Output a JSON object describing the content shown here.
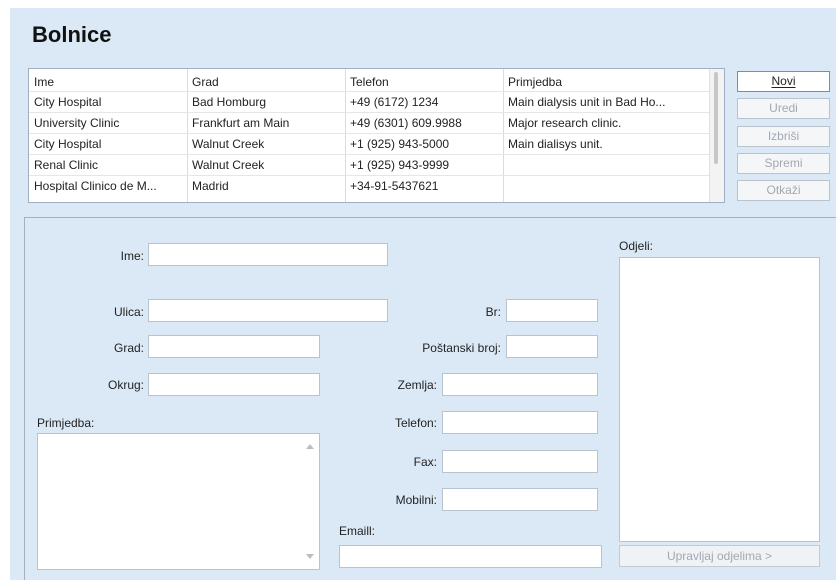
{
  "page": {
    "title": "Bolnice"
  },
  "table": {
    "columns": [
      "Ime",
      "Grad",
      "Telefon",
      "Primjedba"
    ],
    "rows": [
      [
        "City Hospital",
        "Bad Homburg",
        "+49 (6172) 1234",
        "Main dialysis unit in Bad Ho..."
      ],
      [
        "University Clinic",
        "Frankfurt am Main",
        "+49 (6301) 609.9988",
        "Major research clinic."
      ],
      [
        "City Hospital",
        "Walnut Creek",
        "+1 (925) 943-5000",
        "Main dialisys unit."
      ],
      [
        "Renal Clinic",
        "Walnut Creek",
        "+1 (925) 943-9999",
        ""
      ],
      [
        "Hospital Clinico de M...",
        "Madrid",
        "+34-91-5437621",
        ""
      ]
    ]
  },
  "buttons": [
    {
      "label": "Novi",
      "enabled": true
    },
    {
      "label": "Uredi",
      "enabled": false
    },
    {
      "label": "Izbriši",
      "enabled": false
    },
    {
      "label": "Spremi",
      "enabled": false
    },
    {
      "label": "Otkaži",
      "enabled": false
    }
  ],
  "form": {
    "ime_label": "Ime:",
    "ime_value": "",
    "ulica_label": "Ulica:",
    "ulica_value": "",
    "br_label": "Br:",
    "br_value": "",
    "grad_label": "Grad:",
    "grad_value": "",
    "postanski_label": "Poštanski broj:",
    "postanski_value": "",
    "okrug_label": "Okrug:",
    "okrug_value": "",
    "zemlja_label": "Zemlja:",
    "zemlja_value": "",
    "telefon_label": "Telefon:",
    "telefon_value": "",
    "fax_label": "Fax:",
    "fax_value": "",
    "mobilni_label": "Mobilni:",
    "mobilni_value": "",
    "email_label": "Emaill:",
    "email_value": "",
    "primjedba_label": "Primjedba:",
    "primjedba_value": "",
    "odjeli_label": "Odjeli:",
    "manage_button": "Upravljaj odjelima >"
  },
  "colors": {
    "background": "#dbe9f7",
    "border": "#9fb0c3",
    "disabled_text": "#a2a9b1"
  }
}
